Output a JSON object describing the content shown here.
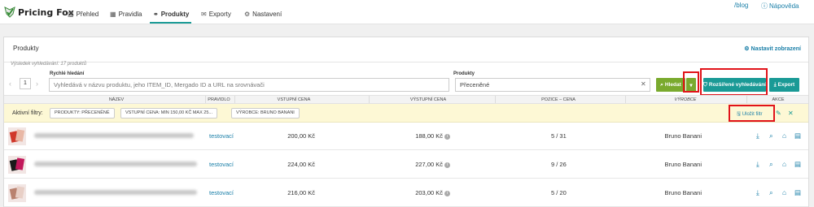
{
  "brand": {
    "name": "Pricing Fox"
  },
  "nav": {
    "items": [
      {
        "label": "Přehled",
        "icon": "bar-chart-icon"
      },
      {
        "label": "Pravidla",
        "icon": "table-icon"
      },
      {
        "label": "Produkty",
        "icon": "tags-icon"
      },
      {
        "label": "Exporty",
        "icon": "envelope-icon"
      },
      {
        "label": "Nastavení",
        "icon": "gear-icon"
      }
    ],
    "active": "Produkty",
    "blog": "/blog",
    "help": "Nápověda"
  },
  "panel": {
    "title": "Produkty",
    "settings_label": "Nastavit zobrazení"
  },
  "search": {
    "result_text": "Výsledek vyhledávání: 17 produktů",
    "quick_label": "Rychlé hledání",
    "quick_placeholder": "Vyhledává v názvu produktu, jeho ITEM_ID, Mergado ID a URL na srovnávači",
    "products_label": "Produkty",
    "products_value": "Přeceněné",
    "page": "1",
    "search_button": "Hledat",
    "advanced_button": "Rozšířené vyhledávání",
    "export_button": "Export"
  },
  "table": {
    "columns": [
      "NÁZEV",
      "PRAVIDLO",
      "VSTUPNÍ CENA",
      "VÝSTUPNÍ CENA",
      "POZICE – CENA",
      "VÝROBCE",
      "AKCE"
    ],
    "rows": [
      {
        "rule": "testovací",
        "input_price": "200,00 Kč",
        "output_price": "188,00 Kč",
        "position": "5 / 31",
        "manufacturer": "Bruno Banani",
        "thumb_colors": [
          "#d0382b",
          "#e9b8a6"
        ]
      },
      {
        "rule": "testovací",
        "input_price": "224,00 Kč",
        "output_price": "227,00 Kč",
        "position": "9 / 26",
        "manufacturer": "Bruno Banani",
        "thumb_colors": [
          "#1a1a1a",
          "#c2185b"
        ]
      },
      {
        "rule": "testovací",
        "input_price": "216,00 Kč",
        "output_price": "203,00 Kč",
        "position": "5 / 20",
        "manufacturer": "Bruno Banani",
        "thumb_colors": [
          "#b9826f",
          "#e8cfc6"
        ]
      }
    ]
  },
  "filters": {
    "label": "Aktivní filtry:",
    "chips": [
      "PRODUKTY: PŘECENĚNÉ",
      "VSTUPNÍ CENA: MIN 150,00 KČ MAX 25...",
      "VÝROBCE: BRUNO BANANI"
    ],
    "save_label": "Uložit filtr"
  },
  "colors": {
    "accent": "#1a9a96",
    "green": "#7aaa2e",
    "link": "#1a7fa8",
    "highlight": "#e1131a"
  }
}
